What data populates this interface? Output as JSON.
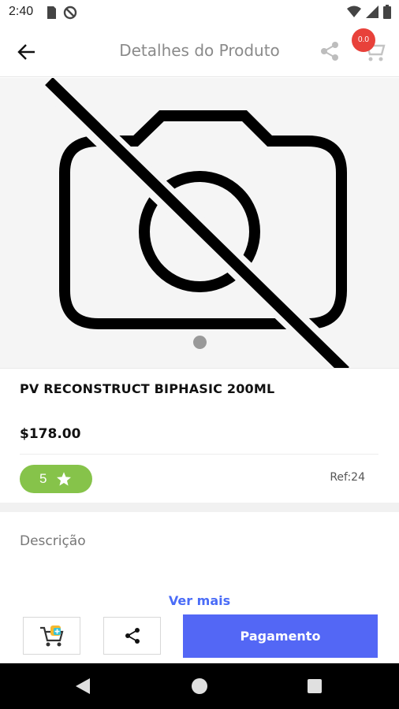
{
  "status_bar": {
    "time": "2:40",
    "icons": [
      "sd-card-icon",
      "no-location-icon",
      "wifi-icon",
      "signal-icon",
      "battery-icon"
    ]
  },
  "app_bar": {
    "title": "Detalhes do Produto",
    "cart_badge": "0.0",
    "icons": [
      "back-arrow-icon",
      "share-icon",
      "cart-icon"
    ]
  },
  "product": {
    "image_icon": "no-camera-icon",
    "name": "PV RECONSTRUCT BIPHASIC 200ML",
    "price": "$178.00",
    "rating": "5",
    "ref": "Ref:24"
  },
  "description": {
    "label": "Descrição",
    "see_more": "Ver mais"
  },
  "actions": {
    "pay_label": "Pagamento",
    "icons": [
      "add-to-cart-icon",
      "share-icon"
    ]
  },
  "colors": {
    "accent_blue": "#5367f5",
    "link_blue": "#4a6cf7",
    "rating_green": "#86c34a",
    "badge_red": "#e8413a"
  }
}
